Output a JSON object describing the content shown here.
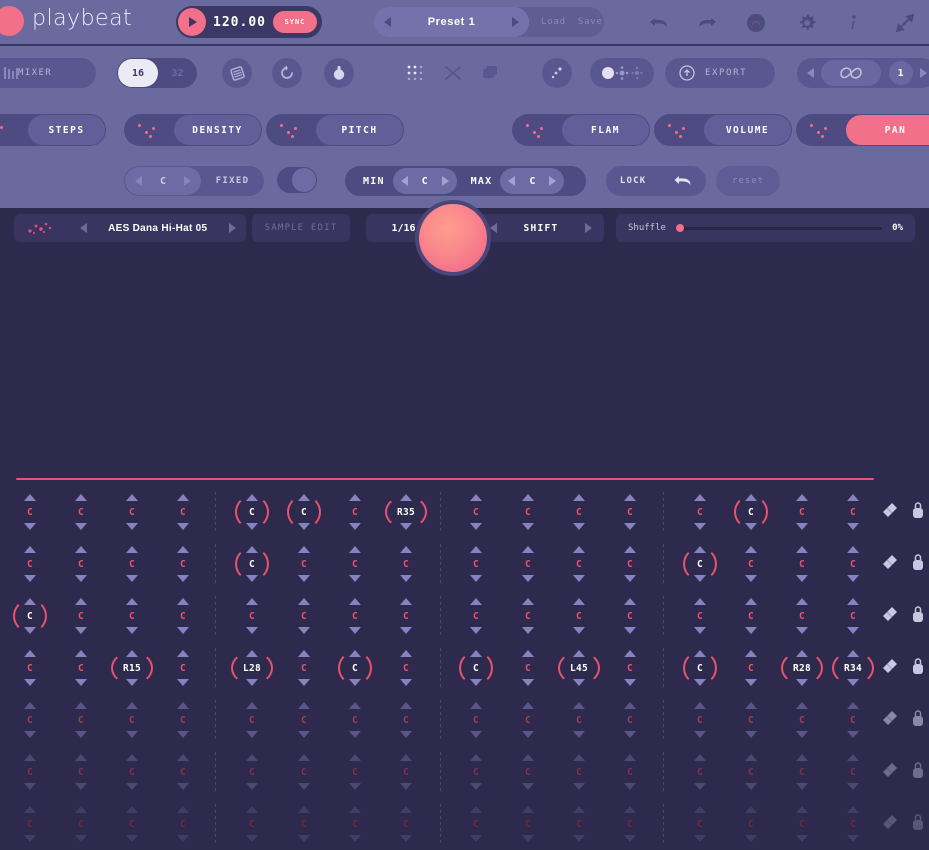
{
  "app": {
    "name": "playbeat"
  },
  "header": {
    "bpm": "120.00",
    "sync_label": "SYNC",
    "preset_name": "Preset 1",
    "load_label": "Load",
    "save_label": "Save",
    "icons": [
      "undo-icon",
      "redo-icon",
      "help-circle-icon",
      "gear-icon",
      "info-icon",
      "resize-icon"
    ]
  },
  "toolbar": {
    "mixer_label": "MIXER",
    "steps_16": "16",
    "steps_32": "32",
    "export_label": "EXPORT",
    "loop_value": "1"
  },
  "params": [
    {
      "label": "STEPS",
      "active": false
    },
    {
      "label": "DENSITY",
      "active": false
    },
    {
      "label": "PITCH",
      "active": false
    },
    {
      "label": "FLAM",
      "active": false
    },
    {
      "label": "VOLUME",
      "active": false
    },
    {
      "label": "PAN",
      "active": true
    }
  ],
  "range": {
    "fixed_value": "C",
    "fixed_label": "FIXED",
    "min_label": "MIN",
    "min_value": "C",
    "max_label": "MAX",
    "max_value": "C",
    "lock_label": "LOCK",
    "reset_label": "reset"
  },
  "sequencer_header": {
    "sample_name": "AES Dana Hi-Hat 05",
    "sample_edit_label": "SAMPLE EDIT",
    "rate": "1/16",
    "shift_label": "SHIFT",
    "shuffle_label": "Shuffle",
    "shuffle_percent": "0%",
    "shuffle_position": 0
  },
  "colors": {
    "accent_pink": "#f2708a",
    "accent_red": "#e8536f",
    "panel_purple": "#6a6a9e",
    "grid_bg": "#2e2a4d",
    "arrow_blue": "#8683c0"
  },
  "grid": {
    "columns": 16,
    "rows": [
      {
        "dim": 0,
        "cells": [
          "C",
          "C",
          "C",
          "C",
          "C",
          "C",
          "C",
          "R35",
          "C",
          "C",
          "C",
          "C",
          "C",
          "C",
          "C",
          "C"
        ],
        "active": [
          false,
          false,
          false,
          false,
          true,
          true,
          false,
          true,
          false,
          false,
          false,
          false,
          false,
          true,
          false,
          false
        ]
      },
      {
        "dim": 0,
        "cells": [
          "C",
          "C",
          "C",
          "C",
          "C",
          "C",
          "C",
          "C",
          "C",
          "C",
          "C",
          "C",
          "C",
          "C",
          "C",
          "C"
        ],
        "active": [
          false,
          false,
          false,
          false,
          true,
          false,
          false,
          false,
          false,
          false,
          false,
          false,
          true,
          false,
          false,
          false
        ]
      },
      {
        "dim": 0,
        "cells": [
          "C",
          "C",
          "C",
          "C",
          "C",
          "C",
          "C",
          "C",
          "C",
          "C",
          "C",
          "C",
          "C",
          "C",
          "C",
          "C"
        ],
        "active": [
          true,
          false,
          false,
          false,
          false,
          false,
          false,
          false,
          false,
          false,
          false,
          false,
          false,
          false,
          false,
          false
        ]
      },
      {
        "dim": 0,
        "cells": [
          "C",
          "C",
          "R15",
          "C",
          "L28",
          "C",
          "C",
          "C",
          "C",
          "C",
          "L45",
          "C",
          "C",
          "C",
          "R28",
          "R34"
        ],
        "active": [
          false,
          false,
          true,
          false,
          true,
          false,
          true,
          false,
          true,
          false,
          true,
          false,
          true,
          false,
          true,
          true
        ]
      },
      {
        "dim": 1,
        "cells": [
          "C",
          "C",
          "C",
          "C",
          "C",
          "C",
          "C",
          "C",
          "C",
          "C",
          "C",
          "C",
          "C",
          "C",
          "C",
          "C"
        ],
        "active": [
          false,
          false,
          false,
          false,
          false,
          false,
          false,
          false,
          false,
          false,
          false,
          false,
          false,
          false,
          false,
          false
        ]
      },
      {
        "dim": 2,
        "cells": [
          "C",
          "C",
          "C",
          "C",
          "C",
          "C",
          "C",
          "C",
          "C",
          "C",
          "C",
          "C",
          "C",
          "C",
          "C",
          "C"
        ],
        "active": [
          false,
          false,
          false,
          false,
          false,
          false,
          false,
          false,
          false,
          false,
          false,
          false,
          false,
          false,
          false,
          false
        ]
      },
      {
        "dim": 3,
        "cells": [
          "C",
          "C",
          "C",
          "C",
          "C",
          "C",
          "C",
          "C",
          "C",
          "C",
          "C",
          "C",
          "C",
          "C",
          "C",
          "C"
        ],
        "active": [
          false,
          false,
          false,
          false,
          false,
          false,
          false,
          false,
          false,
          false,
          false,
          false,
          false,
          false,
          false,
          false
        ]
      }
    ],
    "row_tools": [
      "eraser-icon",
      "lock-icon"
    ]
  }
}
